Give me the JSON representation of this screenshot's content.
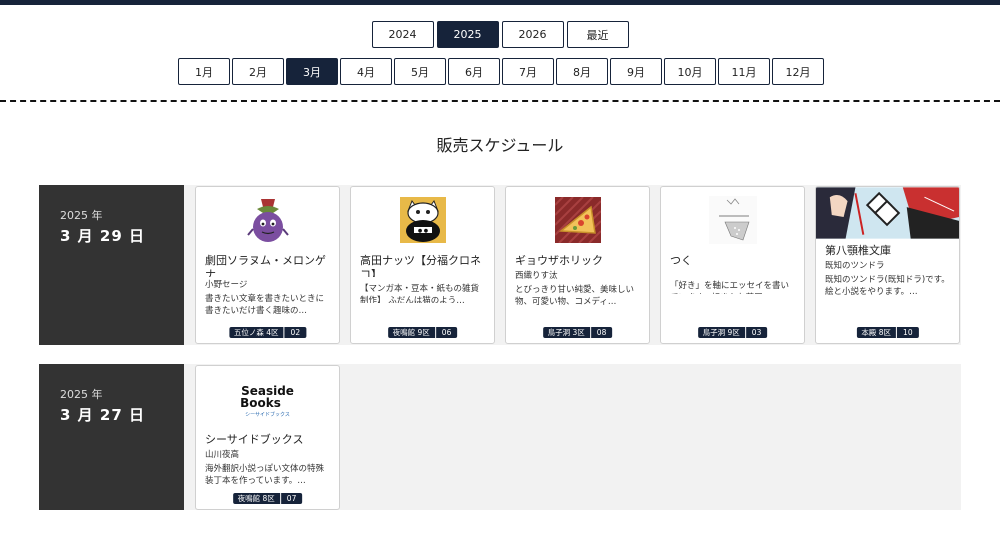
{
  "years": [
    {
      "label": "2024",
      "active": false
    },
    {
      "label": "2025",
      "active": true
    },
    {
      "label": "2026",
      "active": false
    },
    {
      "label": "最近",
      "active": false
    }
  ],
  "months": [
    {
      "label": "1月",
      "active": false
    },
    {
      "label": "2月",
      "active": false
    },
    {
      "label": "3月",
      "active": true
    },
    {
      "label": "4月",
      "active": false
    },
    {
      "label": "5月",
      "active": false
    },
    {
      "label": "6月",
      "active": false
    },
    {
      "label": "7月",
      "active": false
    },
    {
      "label": "8月",
      "active": false
    },
    {
      "label": "9月",
      "active": false
    },
    {
      "label": "10月",
      "active": false
    },
    {
      "label": "11月",
      "active": false
    },
    {
      "label": "12月",
      "active": false
    }
  ],
  "section_title": "販売スケジュール",
  "colors": {
    "navy": "#16233a",
    "date_bg": "#333333",
    "row_bg": "#f2f2f2"
  },
  "dates": [
    {
      "year": "2025 年",
      "day": "3 月 29 日",
      "cards": [
        {
          "thumb": "eggplant-illustration",
          "title": "劇団ソラヌム・メロンゲナ",
          "author": "小野セージ",
          "desc": "書きたい文章を書きたいときに書きたいだけ書く趣味の…",
          "location": "五位ノ森 4区",
          "number": "02"
        },
        {
          "thumb": "cat-illustration",
          "title": "高田ナッツ【分福クロネコ】",
          "author": "",
          "desc": "【マンガ本・豆本・紙もの雑貨制作】 ふだんは猫のよう…",
          "location": "夜鳴館 9区",
          "number": "06"
        },
        {
          "thumb": "pizza-illustration",
          "title": "ギョウザホリック",
          "author": "西織りす汰",
          "desc": "とびっきり甘い純愛、美味しい物、可愛い物、コメディ…",
          "location": "鳥子洞 3区",
          "number": "08"
        },
        {
          "thumb": "sketch-illustration",
          "title": "つく",
          "author": "",
          "desc": "「好き」を軸にエッセイを書いています。好きなお芝居…",
          "location": "鳥子洞 9区",
          "number": "03"
        },
        {
          "thumb": "manga-illustration",
          "title": "第八顎椎文庫",
          "author": "既知のツンドラ",
          "desc": "既知のツンドラ(既知ドラ)です。絵と小説をやります。…",
          "location": "本殿 8区",
          "number": "10"
        }
      ]
    },
    {
      "year": "2025 年",
      "day": "3 月 27 日",
      "cards": [
        {
          "thumb": "seaside-books-logo",
          "logo_line1": "Seaside",
          "logo_line2": "Books",
          "logo_sub": "シーサイドブックス",
          "title": "シーサイドブックス",
          "author": "山川夜高",
          "desc": "海外翻訳小説っぽい文体の特殊装丁本を作っています。…",
          "location": "夜鳴館 8区",
          "number": "07"
        }
      ]
    }
  ]
}
